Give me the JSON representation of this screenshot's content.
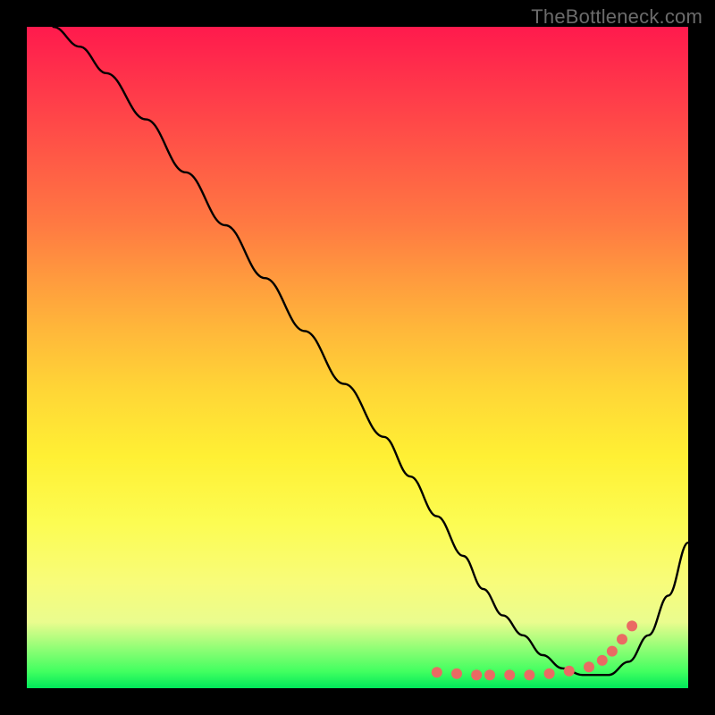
{
  "watermark": "TheBottleneck.com",
  "colors": {
    "frame": "#000000",
    "curve": "#000000",
    "dot": "#ea6a63"
  },
  "chart_data": {
    "type": "line",
    "title": "",
    "xlabel": "",
    "ylabel": "",
    "xlim": [
      0,
      100
    ],
    "ylim": [
      0,
      100
    ],
    "grid": false,
    "legend": false,
    "series": [
      {
        "name": "bottleneck-curve",
        "x": [
          4,
          8,
          12,
          18,
          24,
          30,
          36,
          42,
          48,
          54,
          58,
          62,
          66,
          69,
          72,
          75,
          78,
          81,
          84,
          86,
          88,
          91,
          94,
          97,
          100
        ],
        "y": [
          100,
          97,
          93,
          86,
          78,
          70,
          62,
          54,
          46,
          38,
          32,
          26,
          20,
          15,
          11,
          8,
          5,
          3,
          2,
          2,
          2,
          4,
          8,
          14,
          22
        ]
      }
    ],
    "dots": {
      "name": "optimal-range-markers",
      "x": [
        62,
        65,
        68,
        70,
        73,
        76,
        79,
        82,
        85,
        87,
        88.5,
        90,
        91.5
      ],
      "y": [
        2.4,
        2.2,
        2.0,
        2.0,
        2.0,
        2.0,
        2.2,
        2.6,
        3.2,
        4.2,
        5.6,
        7.4,
        9.4
      ]
    }
  }
}
